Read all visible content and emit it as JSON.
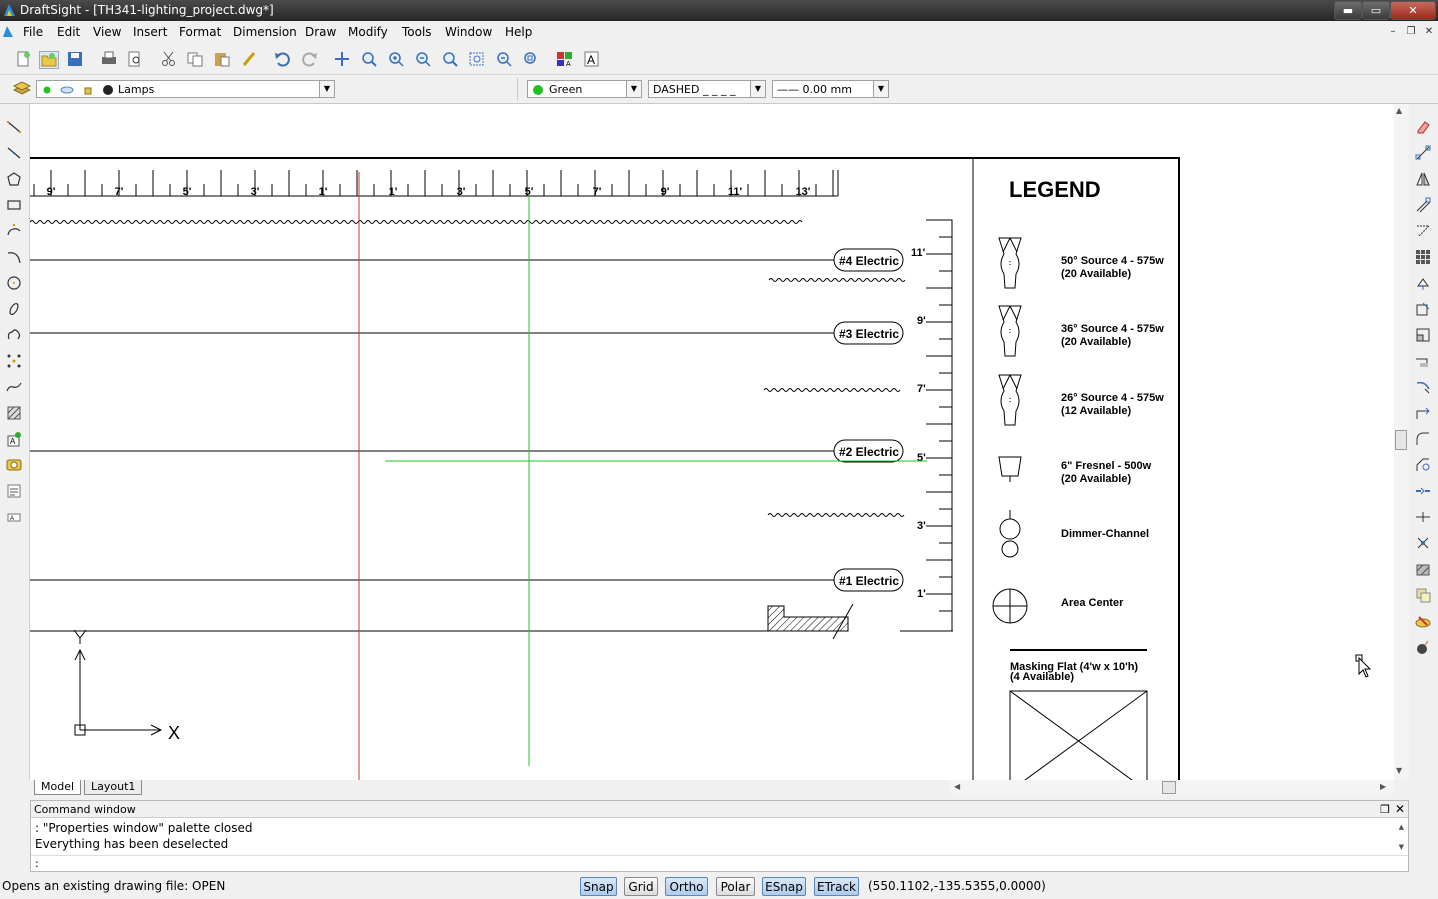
{
  "window": {
    "title": "DraftSight - [TH341-lighting_project.dwg*]",
    "min": "▬",
    "max": "▭",
    "close": "✕"
  },
  "menu": [
    "File",
    "Edit",
    "View",
    "Insert",
    "Format",
    "Dimension",
    "Draw",
    "Modify",
    "Tools",
    "Window",
    "Help"
  ],
  "mdi": {
    "min": "–",
    "restore": "❐",
    "close": "✕"
  },
  "toolbar1": [
    "new-icon",
    "open-icon",
    "save-icon",
    "print-icon",
    "print-preview-icon",
    "cut-icon",
    "copy-icon",
    "paste-icon",
    "format-painter-icon",
    "undo-icon",
    "redo-icon",
    "pan-icon",
    "zoom-realtime-icon",
    "zoom-in-icon",
    "zoom-out-icon",
    "zoom-previous-icon",
    "zoom-window-icon",
    "zoom-fit-icon",
    "zoom-all-icon",
    "attribute-icon",
    "text-style-icon"
  ],
  "layer_bar": {
    "layer_name": "Lamps",
    "color_name": "Green",
    "color_hex": "#22c022",
    "linetype": "DASHED _ _ _ _",
    "lineweight": "—— 0.00 mm"
  },
  "left_tools": [
    "line-icon",
    "polyline-icon",
    "polygon-icon",
    "rectangle-icon",
    "arc-icon",
    "spline-arc-icon",
    "circle-icon",
    "ellipse-icon",
    "cloud-icon",
    "point-icon",
    "spline-icon",
    "hatch-icon",
    "block-insert-icon",
    "block-icon",
    "text-icon",
    "note-icon"
  ],
  "right_tools": [
    "erase-icon",
    "copy-entity-icon",
    "mirror-icon",
    "offset-icon",
    "pattern-icon",
    "array-icon",
    "move-icon",
    "rotate-icon",
    "scale-icon",
    "stretch-icon",
    "trim-icon",
    "extend-icon",
    "fillet-icon",
    "chamfer-icon",
    "join-icon",
    "break-icon",
    "explode-icon",
    "edit-hatch-icon",
    "layer-icon",
    "properties-icon",
    "bomb-icon"
  ],
  "drawing": {
    "ruler_labels": [
      "9'",
      "7'",
      "5'",
      "3'",
      "1'",
      "1'",
      "3'",
      "5'",
      "7'",
      "9'",
      "11'",
      "13'"
    ],
    "electrics": [
      "#4 Electric",
      "#3 Electric",
      "#2 Electric",
      "#1 Electric"
    ],
    "height_labels": [
      "11'",
      "9'",
      "7'",
      "5'",
      "3'",
      "1'"
    ],
    "legend_title": "LEGEND",
    "legend_items": [
      {
        "line1": "50° Source 4 - 575w",
        "line2": "(20 Available)"
      },
      {
        "line1": "36° Source 4 - 575w",
        "line2": "(20 Available)"
      },
      {
        "line1": "26° Source 4 - 575w",
        "line2": "(12 Available)"
      },
      {
        "line1": "6\" Fresnel - 500w",
        "line2": "(20 Available)"
      },
      {
        "line1": "Dimmer-Channel",
        "line2": ""
      },
      {
        "line1": "Area Center",
        "line2": ""
      }
    ],
    "masking_line1": "Masking Flat (4'w x 10'h)",
    "masking_line2": "(4 Available)",
    "ucs_x": "X",
    "ucs_y": "Y"
  },
  "tabs": [
    "Model",
    "Layout1"
  ],
  "command_window": {
    "title": "Command window",
    "lines": [
      ": \"Properties window\" palette closed",
      "Everything has been deselected"
    ],
    "prompt": ":"
  },
  "status": {
    "message": "Opens an existing drawing file:  OPEN",
    "buttons": [
      {
        "label": "Snap",
        "on": true
      },
      {
        "label": "Grid",
        "on": false
      },
      {
        "label": "Ortho",
        "on": true
      },
      {
        "label": "Polar",
        "on": false
      },
      {
        "label": "ESnap",
        "on": true
      },
      {
        "label": "ETrack",
        "on": true
      }
    ],
    "coords": "(550.1102,-135.5355,0.0000)"
  }
}
